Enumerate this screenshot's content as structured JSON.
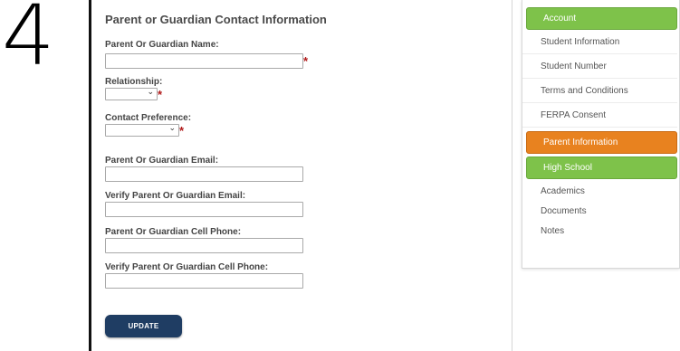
{
  "step": {
    "number": "4"
  },
  "form": {
    "title": "Parent or Guardian Contact Information",
    "fields": {
      "guardian_name": {
        "label": "Parent Or Guardian Name:",
        "value": "",
        "required": "*"
      },
      "relationship": {
        "label": "Relationship:",
        "selected": "",
        "required": "*"
      },
      "contact_preference": {
        "label": "Contact Preference:",
        "selected": "",
        "required": "*"
      },
      "guardian_email": {
        "label": "Parent Or Guardian Email:",
        "value": ""
      },
      "verify_email": {
        "label": "Verify Parent Or Guardian Email:",
        "value": ""
      },
      "cell_phone": {
        "label": "Parent Or Guardian Cell Phone:",
        "value": ""
      },
      "verify_cell_phone": {
        "label": "Verify Parent Or Guardian Cell Phone:",
        "value": ""
      }
    },
    "update_label": "UPDATE"
  },
  "nav": {
    "items": [
      {
        "label": "Account",
        "status": "complete",
        "color": "#7ec24a"
      },
      {
        "label": "Student Information"
      },
      {
        "label": "Student Number"
      },
      {
        "label": "Terms and Conditions"
      },
      {
        "label": "FERPA Consent"
      },
      {
        "label": "Parent Information",
        "status": "current",
        "color": "#e8821f"
      },
      {
        "label": "High School",
        "status": "complete",
        "color": "#7ec24a"
      },
      {
        "label": "Academics"
      },
      {
        "label": "Documents"
      },
      {
        "label": "Notes"
      }
    ]
  },
  "colors": {
    "accent_green": "#7ec24a",
    "accent_orange": "#e8821f",
    "button_navy": "#1f3d63",
    "required_red": "#b01818"
  }
}
